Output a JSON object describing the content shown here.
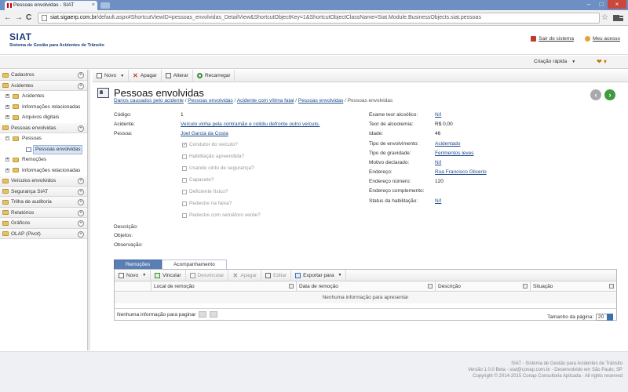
{
  "browser": {
    "tab_title": "Pessoas envolvidas - SIAT",
    "url_domain": "siat.sigaerp.com.br",
    "url_path": "/default.aspx#ShortcutViewID=pessoas_envolvidas_DetailView&ShortcutObjectKey=1&ShortcutObjectClassName=Siat.Module.BusinessObjects.siat.pessoas",
    "tab_close": "×",
    "back": "←",
    "forward": "→",
    "reload": "C",
    "star": "☆",
    "win_min": "–",
    "win_max": "□",
    "win_close": "×"
  },
  "app": {
    "logo": "SIAT",
    "logo_subtitle": "Sistema de Gestão para Acidentes de Trânsito",
    "logout": "Sair do sistema",
    "my_account": "Meu acesso",
    "quick_create": "Criação rápida",
    "quick_caret": "▼",
    "quick_icons": "❤ ▾"
  },
  "sidebar": {
    "toggle": "+",
    "pm_plus": "+",
    "pm_minus": "−",
    "items": [
      {
        "label": "Cadastros"
      },
      {
        "label": "Acidentes"
      },
      {
        "label": "Acidentes"
      },
      {
        "label": "Informações relacionadas"
      },
      {
        "label": "Arquivos digitais"
      },
      {
        "label": "Pessoas envolvidas"
      },
      {
        "label": "Pessoas"
      },
      {
        "label": "Pessoas envolvidas"
      },
      {
        "label": "Remoções"
      },
      {
        "label": "Informações relacionadas"
      },
      {
        "label": "Veículos envolvidos"
      },
      {
        "label": "Segurança SIAT"
      },
      {
        "label": "Trilha de auditoria"
      },
      {
        "label": "Relatórios"
      },
      {
        "label": "Gráficos"
      },
      {
        "label": "OLAP (Pivot)"
      }
    ]
  },
  "toolbar": {
    "new": "Novo",
    "delete": "Apagar",
    "edit": "Alterar",
    "refresh": "Recarregar",
    "dd": "▼"
  },
  "page": {
    "title": "Pessoas envolvidas",
    "back_arrow": "‹",
    "fwd_arrow": "›",
    "breadcrumb": [
      "Danos causados pelo acidente",
      "Pessoas envolvidas",
      "Acidente com vítima fatal",
      "Pessoas envolvidas",
      "Pessoas envolvidas"
    ],
    "breadcrumb_sep": " / "
  },
  "left_fields": {
    "codigo_label": "Código:",
    "codigo_value": "1",
    "acidente_label": "Acidente:",
    "acidente_value": "Veículo vinha pela contramão e colidiu defronte outro veículo.",
    "pessoa_label": "Pessoa:",
    "pessoa_value": "Joel Garcia da Costa",
    "descricao_label": "Descrição:",
    "objetos_label": "Objetos:",
    "observacao_label": "Observação:"
  },
  "checkboxes": {
    "checked_mark": "✓",
    "items": [
      {
        "label": "Condutor do veículo?",
        "checked": true
      },
      {
        "label": "Habilitação apreendida?",
        "checked": false
      },
      {
        "label": "Usando cinto de segurança?",
        "checked": false
      },
      {
        "label": "Capacete?",
        "checked": false
      },
      {
        "label": "Deficiente físico?",
        "checked": false
      },
      {
        "label": "Pedestre na faixa?",
        "checked": false
      },
      {
        "label": "Pedestre com semáforo verde?",
        "checked": false
      }
    ]
  },
  "right_fields": [
    {
      "label": "Exame teor alcoólico:",
      "value": "N/I",
      "link": true
    },
    {
      "label": "Teor de alcoolemia:",
      "value": "R$ 0,00",
      "link": false
    },
    {
      "label": "Idade:",
      "value": "46",
      "link": false
    },
    {
      "label": "Tipo de envolvimento:",
      "value": "Acidentado",
      "link": true
    },
    {
      "label": "Tipo de gravidade:",
      "value": "Ferimentos leves",
      "link": true
    },
    {
      "label": "Motivo declarado:",
      "value": "N/I",
      "link": true
    },
    {
      "label": "Endereço:",
      "value": "Rua Francisco Glicerio",
      "link": true
    },
    {
      "label": "Endereço número:",
      "value": "120",
      "link": false
    },
    {
      "label": "Endereço complemento:",
      "value": "",
      "link": false
    },
    {
      "label": "Status da habilitação:",
      "value": "N/I",
      "link": true
    }
  ],
  "tabs": {
    "removals": "Remoções",
    "followup": "Acompanhamento"
  },
  "grid": {
    "new": "Novo",
    "link": "Vincular",
    "unlink": "Desvincular",
    "delete": "Apagar",
    "edit": "Editar",
    "export": "Exportar para",
    "dd": "▼",
    "columns": [
      "Local de remoção",
      "Data de remoção",
      "Descrição",
      "Situação"
    ],
    "empty": "Nenhuma informação para apresentar",
    "footer_empty": "Nenhuma informação para paginar",
    "page_size_label": "Tamanho da página:",
    "page_size": "20"
  },
  "footer": {
    "line1": "SIAT - Sistema de Gestão para Acidentes de Trânsito",
    "line2": "Versão 1.0.0 Beta - siat@conap.com.br - Desenvolvido em São Paulo, SP",
    "line3": "Copyright © 2014-2015 Conap Consultoria Aplicada - All rights reserved"
  }
}
